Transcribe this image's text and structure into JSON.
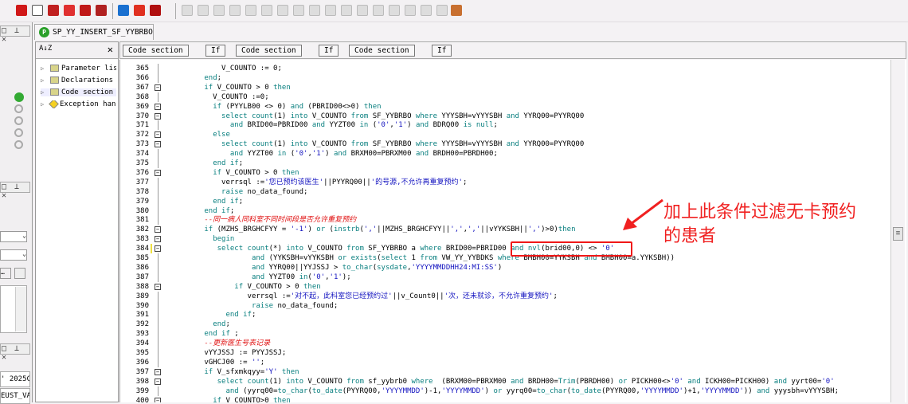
{
  "toolbar": {
    "icons": [
      "new-object",
      "open",
      "save",
      "compile",
      "execute",
      "debug",
      "arrow-right-blue",
      "arrow-right-red",
      "stop"
    ]
  },
  "document_tab": {
    "title": "SP_YY_INSERT_SF_YYBRBO",
    "icon": "P"
  },
  "left_panel": {
    "value_1": "' 2025C",
    "value_2": "EUST_VA"
  },
  "tree": {
    "sort_icon": "A↓Z",
    "close": "✕",
    "items": [
      {
        "label": "Parameter list"
      },
      {
        "label": "Declarations"
      },
      {
        "label": "Code section"
      },
      {
        "label": "Exception handler"
      }
    ]
  },
  "breadcrumbs": [
    "Code section",
    "If",
    "Code section",
    "If",
    "Code section",
    "If"
  ],
  "annotation": {
    "line1": "加上此条件过滤无卡预约",
    "line2": "的患者",
    "highlighted": "and nvl(brid00,0) <> '0'"
  },
  "code": [
    {
      "n": "365",
      "fold": false,
      "text": "            V_COUNTO := 0;"
    },
    {
      "n": "366",
      "fold": false,
      "text": "        end;"
    },
    {
      "n": "367",
      "fold": true,
      "text": "        if V_COUNTO > 0 then"
    },
    {
      "n": "368",
      "fold": false,
      "text": "          V_COUNTO :=0;"
    },
    {
      "n": "369",
      "fold": true,
      "text": "          if (PYYLB00 <> 0) and (PBRID00<>0) then"
    },
    {
      "n": "370",
      "fold": true,
      "text": "            select count(1) into V_COUNTO from SF_YYBRBO where YYYSBH=vYYYSBH and YYRQ00=PYYRQ00"
    },
    {
      "n": "371",
      "fold": false,
      "text": "              and BRID00=PBRID00 and YYZT00 in ('0','1') and BDRQ00 is null;"
    },
    {
      "n": "372",
      "fold": true,
      "text": "          else"
    },
    {
      "n": "373",
      "fold": true,
      "text": "            select count(1) into V_COUNTO from SF_YYBRBO where YYYSBH=vYYYSBH and YYRQ00=PYYRQ00"
    },
    {
      "n": "374",
      "fold": false,
      "text": "              and YYZT00 in ('0','1') and BRXM00=PBRXM00 and BRDH00=PBRDH00;"
    },
    {
      "n": "375",
      "fold": false,
      "text": "          end if;"
    },
    {
      "n": "376",
      "fold": true,
      "text": "          if V_COUNTO > 0 then"
    },
    {
      "n": "377",
      "fold": false,
      "text": "            verrsql :='您已预约该医生'||PYYRQ00||'的号源,不允许再重复预约';"
    },
    {
      "n": "378",
      "fold": false,
      "text": "            raise no_data_found;"
    },
    {
      "n": "379",
      "fold": false,
      "text": "          end if;"
    },
    {
      "n": "380",
      "fold": false,
      "text": "        end if;"
    },
    {
      "n": "381",
      "fold": false,
      "comment": true,
      "text": "        --同一病人同科室不同时间段是否允许重复预约"
    },
    {
      "n": "382",
      "fold": true,
      "text": "        if (MZHS_BRGHCFYY = '-1') or (instrb(','||MZHS_BRGHCFYY||',',','||vYYKSBH||',')>0)then"
    },
    {
      "n": "383",
      "fold": true,
      "text": "          begin"
    },
    {
      "n": "384",
      "fold": true,
      "text": "           select count(*) into V_COUNTO from SF_YYBRBO a where BRID00=PBRID00 and nvl(brid00,0) <> '0'"
    },
    {
      "n": "385",
      "fold": false,
      "text": "                   and (YYKSBH=vYYKSBH or exists(select 1 from VW_YY_YYBDKS where BMBH00=YYKSBH and BMBH00=a.YYKSBH))"
    },
    {
      "n": "386",
      "fold": false,
      "text": "                   and YYRQ00||YYJSSJ > to_char(sysdate,'YYYYMMDDHH24:MI:SS')"
    },
    {
      "n": "387",
      "fold": false,
      "text": "                   and YYZT00 in('0','1');"
    },
    {
      "n": "388",
      "fold": true,
      "text": "               if V_COUNTO > 0 then"
    },
    {
      "n": "389",
      "fold": false,
      "text": "                  verrsql :='对不起，此科室您已经预约过'||v_Count0||'次，还未就诊，不允许重复预约';"
    },
    {
      "n": "390",
      "fold": false,
      "text": "                   raise no_data_found;"
    },
    {
      "n": "391",
      "fold": false,
      "text": "             end if;"
    },
    {
      "n": "392",
      "fold": false,
      "text": "          end;"
    },
    {
      "n": "393",
      "fold": false,
      "text": "        end if ;"
    },
    {
      "n": "394",
      "fold": false,
      "comment": true,
      "text": "        --更新医生号表记录"
    },
    {
      "n": "395",
      "fold": false,
      "text": "        vYYJSSJ := PYYJSSJ;"
    },
    {
      "n": "396",
      "fold": false,
      "text": "        vGHCJ00 := '';"
    },
    {
      "n": "397",
      "fold": true,
      "text": "        if V_sfxmkqyy='Y' then"
    },
    {
      "n": "398",
      "fold": true,
      "text": "           select count(1) into V_COUNTO from sf_yybrb0 where  (BRXM00=PBRXM00 and BRDH00=Trim(PBRDH00) or PICKH00<>'0' and ICKH00=PICKH00) and yyrt00='0'"
    },
    {
      "n": "399",
      "fold": false,
      "text": "             and (yyrq00=to_char(to_date(PYYRQ00,'YYYYMMDD')-1,'YYYYMMDD') or yyrq00=to_char(to_date(PYYRQ00,'YYYYMMDD')+1,'YYYYMMDD')) and yyysbh=vYYYSBH;"
    },
    {
      "n": "400",
      "fold": true,
      "text": "          if V_COUNTO>0 then"
    }
  ],
  "colors": {
    "keyword": "#0b8080",
    "string": "#1515c0",
    "comment": "#e01010",
    "annotation": "#f02020"
  }
}
